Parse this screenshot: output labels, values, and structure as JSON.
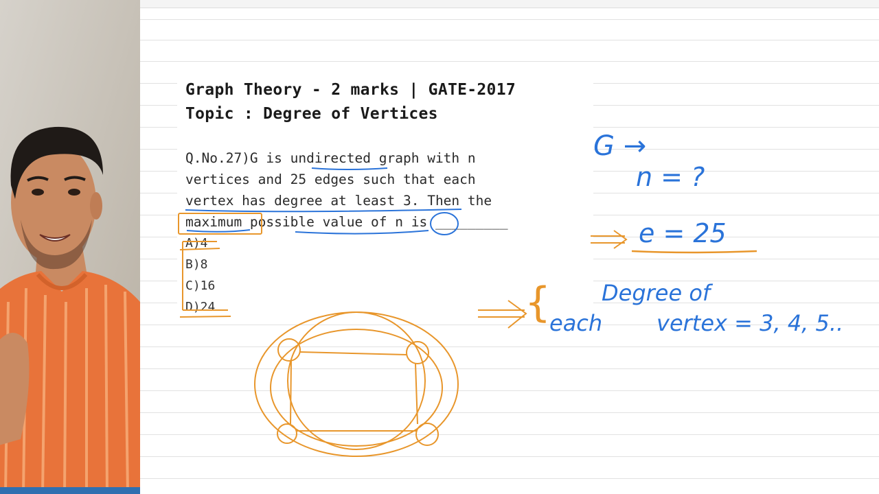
{
  "question": {
    "title_line1": "Graph Theory - 2 marks | GATE-2017",
    "title_line2": "Topic : Degree of Vertices",
    "body_lines": [
      "Q.No.27)G is undirected graph with n",
      "vertices and 25 edges such that each",
      "vertex has degree at least 3. Then the",
      "maximum possible value of n is _________"
    ],
    "options": [
      "A)4",
      "B)8",
      "C)16",
      "D)24"
    ]
  },
  "annotations": {
    "g_arrow": "G →",
    "n_eq": "n = ?",
    "e_eq": "e = 25",
    "arrow_symbol": "⇒",
    "degree_of": "Degree of",
    "each": "each",
    "vertex_eq": "vertex = 3, 4, 5..",
    "brace": "{"
  },
  "colors": {
    "ink_blue": "#2a73d9",
    "ink_orange": "#e8962b",
    "webcam_shirt": "#e8733a",
    "page_bg": "#ffffff",
    "rule_line": "#e1e1e1"
  }
}
